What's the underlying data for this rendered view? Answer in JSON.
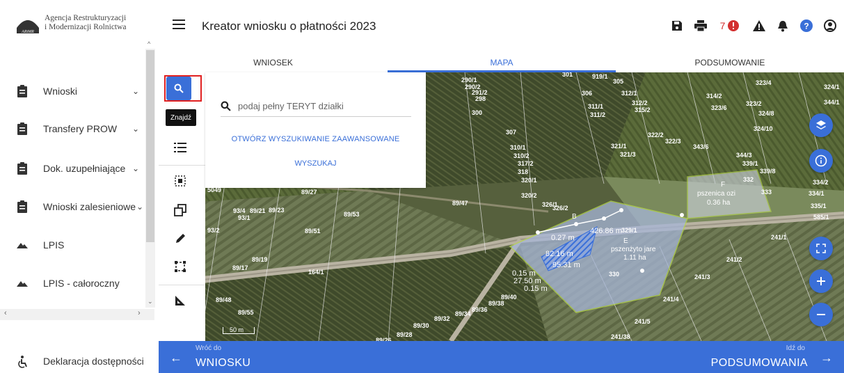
{
  "logo": {
    "line1": "Agencja Restrukturyzacji",
    "line2": "i Modernizacji Rolnictwa",
    "mark_text": "ARiMR"
  },
  "sidebar": {
    "items": [
      {
        "label": "Wnioski",
        "icon": "clipboard-icon",
        "expandable": true
      },
      {
        "label": "Transfery PROW",
        "icon": "clipboard-icon",
        "expandable": true
      },
      {
        "label": "Dok. uzupełniające",
        "icon": "clipboard-icon",
        "expandable": true
      },
      {
        "label": "Wnioski zalesieniowe",
        "icon": "clipboard-icon",
        "expandable": true
      },
      {
        "label": "LPIS",
        "icon": "mountain-icon",
        "expandable": false
      },
      {
        "label": "LPIS - całoroczny",
        "icon": "mountain-icon",
        "expandable": false
      }
    ],
    "accessibility": "Deklaracja dostępności"
  },
  "header": {
    "title": "Kreator wniosku o płatności 2023",
    "notification_count": "7"
  },
  "tabs": [
    {
      "label": "WNIOSEK",
      "active": false
    },
    {
      "label": "MAPA",
      "active": true
    },
    {
      "label": "PODSUMOWANIE",
      "active": false
    }
  ],
  "tools": {
    "search_tooltip": "Znajdź"
  },
  "search": {
    "placeholder": "podaj pełny TERYT działki",
    "advanced_link": "OTWÓRZ WYSZUKIWANIE ZAAWANSOWANE",
    "submit": "WYSZUKAJ"
  },
  "map": {
    "scale": "50 m",
    "parcels": [
      {
        "id": "290/1"
      },
      {
        "id": "290/2"
      },
      {
        "id": "291/2"
      },
      {
        "id": "298"
      },
      {
        "id": "300"
      },
      {
        "id": "301"
      },
      {
        "id": "919/1"
      },
      {
        "id": "305"
      },
      {
        "id": "306"
      },
      {
        "id": "312/1"
      },
      {
        "id": "311/1"
      },
      {
        "id": "311/2"
      },
      {
        "id": "312/2"
      },
      {
        "id": "315/2"
      },
      {
        "id": "314/2"
      },
      {
        "id": "323/2"
      },
      {
        "id": "323/4"
      },
      {
        "id": "323/6"
      },
      {
        "id": "324/8"
      },
      {
        "id": "324/1"
      },
      {
        "id": "344/1"
      },
      {
        "id": "324/10"
      },
      {
        "id": "307"
      },
      {
        "id": "310/1"
      },
      {
        "id": "310/2"
      },
      {
        "id": "317/2"
      },
      {
        "id": "318"
      },
      {
        "id": "320/1"
      },
      {
        "id": "320/2"
      },
      {
        "id": "326/1"
      },
      {
        "id": "326/2"
      },
      {
        "id": "321/1"
      },
      {
        "id": "321/3"
      },
      {
        "id": "322/2"
      },
      {
        "id": "322/3"
      },
      {
        "id": "343/6"
      },
      {
        "id": "344/3"
      },
      {
        "id": "339/1"
      },
      {
        "id": "339/8"
      },
      {
        "id": "332"
      },
      {
        "id": "334/2"
      },
      {
        "id": "334/1"
      },
      {
        "id": "335/1"
      },
      {
        "id": "585/1"
      },
      {
        "id": "333"
      },
      {
        "id": "89/27"
      },
      {
        "id": "89/47"
      },
      {
        "id": "89/53"
      },
      {
        "id": "89/51"
      },
      {
        "id": "93/4"
      },
      {
        "id": "89/21"
      },
      {
        "id": "89/23"
      },
      {
        "id": "93/1"
      },
      {
        "id": "93/2"
      },
      {
        "id": "89/19"
      },
      {
        "id": "89/17"
      },
      {
        "id": "164/1"
      },
      {
        "id": "329/1"
      },
      {
        "id": "330"
      },
      {
        "id": "241/1"
      },
      {
        "id": "241/2"
      },
      {
        "id": "241/3"
      },
      {
        "id": "241/4"
      },
      {
        "id": "241/5"
      },
      {
        "id": "241/38"
      },
      {
        "id": "89/48"
      },
      {
        "id": "89/55"
      },
      {
        "id": "89/30"
      },
      {
        "id": "89/32"
      },
      {
        "id": "89/34"
      },
      {
        "id": "89/36"
      },
      {
        "id": "89/38"
      },
      {
        "id": "89/40"
      },
      {
        "id": "89/28"
      },
      {
        "id": "89/26"
      },
      {
        "id": "5049"
      }
    ],
    "fields": [
      {
        "letter": "E",
        "crop": "pszenżyto jare",
        "area": "1.11 ha"
      },
      {
        "letter": "F",
        "crop": "pszenica ozi",
        "area": "0.36 ha"
      },
      {
        "letter": "B",
        "crop": "",
        "area": ""
      }
    ],
    "measurements": [
      "82.16 m",
      "95.31 m",
      "0.15 m",
      "27.50 m",
      "0.15 m",
      "0.27 m",
      "426.86 m"
    ]
  },
  "bottom": {
    "back_small": "Wróć do",
    "back_big": "WNIOSKU",
    "next_small": "Idź do",
    "next_big": "PODSUMOWANIA"
  },
  "colors": {
    "accent": "#3a6fd8",
    "alert": "#d32f2f",
    "highlight": "#e02020"
  }
}
